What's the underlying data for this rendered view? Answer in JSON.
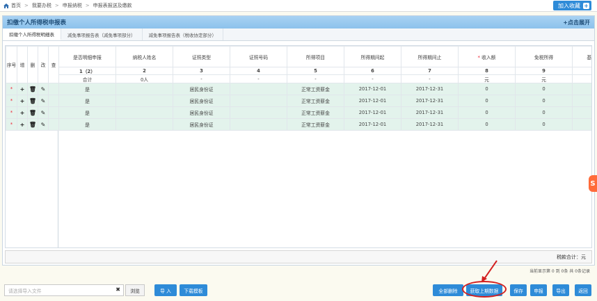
{
  "breadcrumb": {
    "items": [
      "首页",
      "我要办税",
      "申报纳税",
      "申报表报送及缴款"
    ]
  },
  "header": {
    "favorite_label": "加入收藏",
    "favorite_icon": "plus-icon"
  },
  "panel": {
    "title": "扣缴个人所得税申报表",
    "expand_label": "+点击展开"
  },
  "tabs": [
    {
      "label": "扣缴个人所得税明细表"
    },
    {
      "label": "减免事项报告表（减免事项部分）"
    },
    {
      "label": "减免事项报告表（税收协定部分）"
    }
  ],
  "fixed_headers": [
    "序号",
    "增",
    "删",
    "改",
    "查"
  ],
  "columns": [
    {
      "label": "是否明细申报",
      "num": "1（2）",
      "total": "合计",
      "required": false
    },
    {
      "label": "纳税人姓名",
      "num": "2",
      "total": "0人",
      "required": false
    },
    {
      "label": "证照类型",
      "num": "3",
      "total": "-",
      "required": false
    },
    {
      "label": "证照号码",
      "num": "4",
      "total": "-",
      "required": false
    },
    {
      "label": "所得项目",
      "num": "5",
      "total": "-",
      "required": false
    },
    {
      "label": "所得期间起",
      "num": "6",
      "total": "-",
      "required": false
    },
    {
      "label": "所得期间止",
      "num": "7",
      "total": "-",
      "required": false
    },
    {
      "label": "收入额",
      "num": "8",
      "total": "元",
      "required": true
    },
    {
      "label": "免税所得",
      "num": "9",
      "total": "元",
      "required": false
    },
    {
      "label": "基本养",
      "num": "",
      "total": "",
      "required": false
    }
  ],
  "rows": [
    {
      "mark": "*",
      "c1": "是",
      "c2": "",
      "c3": "居民身份证",
      "c4": "",
      "c5": "正常工资薪金",
      "c6": "2017-12-01",
      "c7": "2017-12-31",
      "c8": "0",
      "c9": "0"
    },
    {
      "mark": "*",
      "c1": "是",
      "c2": "",
      "c3": "居民身份证",
      "c4": "",
      "c5": "正常工资薪金",
      "c6": "2017-12-01",
      "c7": "2017-12-31",
      "c8": "0",
      "c9": "0"
    },
    {
      "mark": "*",
      "c1": "是",
      "c2": "",
      "c3": "居民身份证",
      "c4": "",
      "c5": "正常工资薪金",
      "c6": "2017-12-01",
      "c7": "2017-12-31",
      "c8": "0",
      "c9": "0"
    },
    {
      "mark": "*",
      "c1": "是",
      "c2": "",
      "c3": "居民身份证",
      "c4": "",
      "c5": "正常工资薪金",
      "c6": "2017-12-01",
      "c7": "2017-12-31",
      "c8": "0",
      "c9": "0"
    }
  ],
  "total_bar": {
    "text": "税款合计：元"
  },
  "pagination": {
    "text": "当前显示第 0 到 0条  共 0条记录"
  },
  "bottom": {
    "file_placeholder": "请选择导入文件",
    "browse_label": "浏览",
    "import_label": "导 入",
    "download_label": "下载模板",
    "delete_all_label": "全部删除",
    "copy_last_label": "获取上期数据",
    "save_label": "保存",
    "declare_label": "申报",
    "export_label": "导出",
    "back_label": "返回"
  },
  "colors": {
    "accent": "#2e8bd8",
    "row_bg": "#e3f3ec",
    "panel_header": "#8cc2ec",
    "annotation": "#d32020"
  }
}
